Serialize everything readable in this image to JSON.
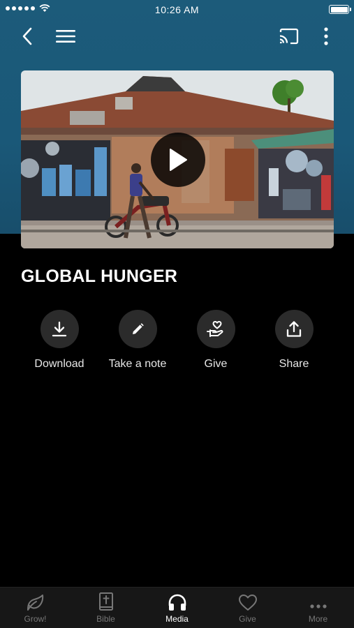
{
  "status_bar": {
    "time": "10:26 AM"
  },
  "nav": {
    "back_icon": "chevron-left",
    "menu_icon": "hamburger",
    "cast_icon": "cast",
    "more_icon": "vertical-dots"
  },
  "video": {
    "thumbnail": "street-market-scene",
    "play_icon": "play"
  },
  "title": "GLOBAL HUNGER",
  "actions": [
    {
      "label": "Download",
      "icon": "download-icon"
    },
    {
      "label": "Take a note",
      "icon": "pencil-icon"
    },
    {
      "label": "Give",
      "icon": "heart-hand-icon"
    },
    {
      "label": "Share",
      "icon": "share-icon"
    }
  ],
  "tabs": [
    {
      "label": "Grow!",
      "icon": "leaf-icon",
      "active": false
    },
    {
      "label": "Bible",
      "icon": "bible-icon",
      "active": false
    },
    {
      "label": "Media",
      "icon": "headphones-icon",
      "active": true
    },
    {
      "label": "Give",
      "icon": "heart-icon",
      "active": false
    },
    {
      "label": "More",
      "icon": "dots-icon",
      "active": false
    }
  ],
  "colors": {
    "header_bg": "#1c5b7a",
    "background": "#000000",
    "tabbar_bg": "#171717",
    "inactive_tab": "#777777",
    "action_circle": "#2b2b2b"
  }
}
